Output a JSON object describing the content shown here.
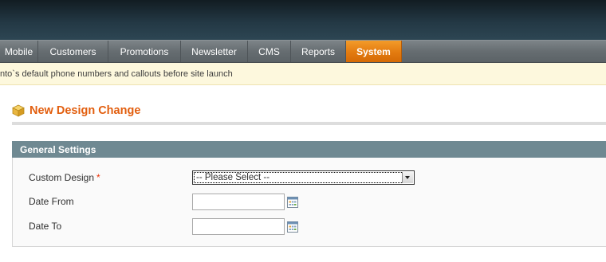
{
  "nav": {
    "items": [
      {
        "label": "Mobile",
        "active": false
      },
      {
        "label": "Customers",
        "active": false
      },
      {
        "label": "Promotions",
        "active": false
      },
      {
        "label": "Newsletter",
        "active": false
      },
      {
        "label": "CMS",
        "active": false
      },
      {
        "label": "Reports",
        "active": false
      },
      {
        "label": "System",
        "active": true
      }
    ]
  },
  "notice": {
    "text": "nto`s default phone numbers and callouts before site launch"
  },
  "page": {
    "title": "New Design Change",
    "title_icon": "package-icon"
  },
  "fieldset": {
    "title": "General Settings",
    "custom_design": {
      "label": "Custom Design",
      "required_mark": "*",
      "value": "-- Please Select --"
    },
    "date_from": {
      "label": "Date From",
      "value": "",
      "icon": "calendar-icon"
    },
    "date_to": {
      "label": "Date To",
      "value": "",
      "icon": "calendar-icon"
    }
  },
  "colors": {
    "accent": "#e25e0e",
    "nav_active": "#e37b10",
    "fieldset_header": "#6f8992",
    "notice_bg": "#fdf8dd"
  }
}
